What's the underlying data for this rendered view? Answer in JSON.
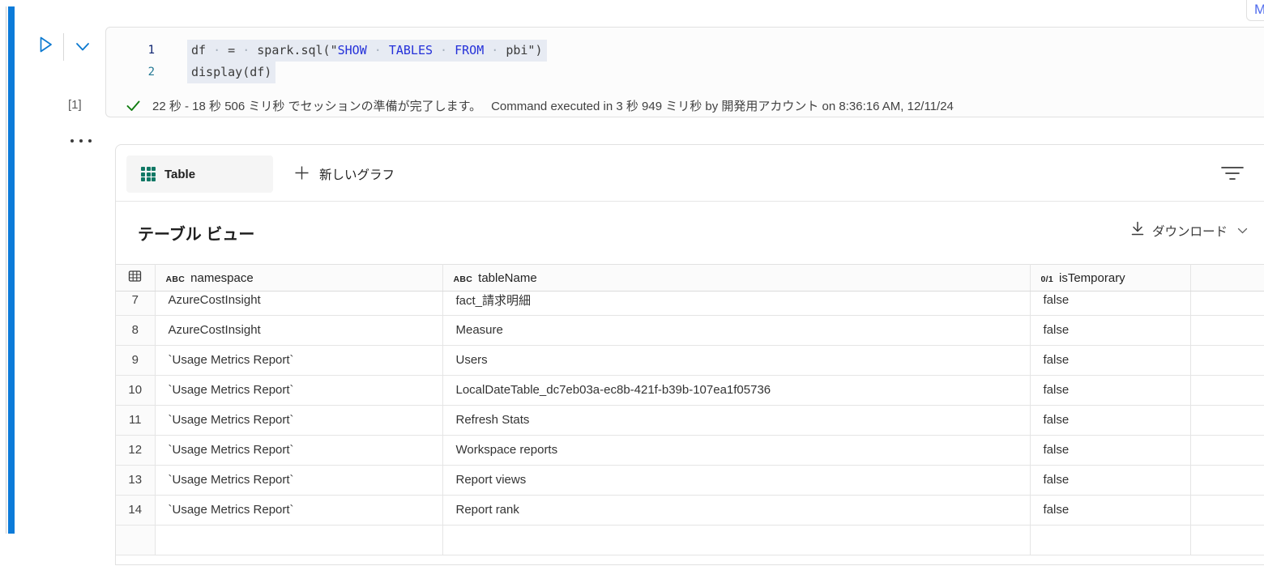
{
  "window": {
    "top_right_partial": "M"
  },
  "notebook_cell": {
    "execution_count": "[1]",
    "code_lines": [
      {
        "number": "1",
        "segments": [
          {
            "t": "df",
            "c": "d"
          },
          {
            "t": "·",
            "c": "w"
          },
          {
            "t": "=",
            "c": "d"
          },
          {
            "t": "·",
            "c": "w"
          },
          {
            "t": "spark.sql(\"",
            "c": "d"
          },
          {
            "t": "SHOW",
            "c": "k"
          },
          {
            "t": "·",
            "c": "w"
          },
          {
            "t": "TABLES",
            "c": "k"
          },
          {
            "t": "·",
            "c": "w"
          },
          {
            "t": "FROM",
            "c": "k"
          },
          {
            "t": "·",
            "c": "w"
          },
          {
            "t": "pbi\")",
            "c": "d"
          }
        ]
      },
      {
        "number": "2",
        "segments": [
          {
            "t": "display(df)",
            "c": "d"
          }
        ]
      }
    ],
    "status": {
      "session_message": "22 秒 - 18 秒 506 ミリ秒 でセッションの準備が完了します。",
      "execution_message": "Command executed in 3 秒 949 ミリ秒 by 開発用アカウント on 8:36:16 AM, 12/11/24"
    }
  },
  "output_panel": {
    "tabs": {
      "table": "Table",
      "new_chart": "新しいグラフ"
    },
    "view_title": "テーブル ビュー",
    "download_label": "ダウンロード",
    "table": {
      "columns": [
        {
          "badge": "ABC",
          "name": "namespace"
        },
        {
          "badge": "ABC",
          "name": "tableName"
        },
        {
          "badge": "0/1",
          "name": "isTemporary"
        }
      ],
      "rows": [
        {
          "num": "7",
          "namespace": "AzureCostInsight",
          "tableName": "fact_請求明細",
          "isTemporary": "false"
        },
        {
          "num": "8",
          "namespace": "AzureCostInsight",
          "tableName": "Measure",
          "isTemporary": "false"
        },
        {
          "num": "9",
          "namespace": "`Usage Metrics Report`",
          "tableName": "Users",
          "isTemporary": "false"
        },
        {
          "num": "10",
          "namespace": "`Usage Metrics Report`",
          "tableName": "LocalDateTable_dc7eb03a-ec8b-421f-b39b-107ea1f05736",
          "isTemporary": "false"
        },
        {
          "num": "11",
          "namespace": "`Usage Metrics Report`",
          "tableName": "Refresh Stats",
          "isTemporary": "false"
        },
        {
          "num": "12",
          "namespace": "`Usage Metrics Report`",
          "tableName": "Workspace reports",
          "isTemporary": "false"
        },
        {
          "num": "13",
          "namespace": "`Usage Metrics Report`",
          "tableName": "Report views",
          "isTemporary": "false"
        },
        {
          "num": "14",
          "namespace": "`Usage Metrics Report`",
          "tableName": "Report rank",
          "isTemporary": "false"
        }
      ]
    }
  },
  "colors": {
    "accent_blue": "#0C7BD9",
    "table_tab_green": "#117865",
    "check_green": "#107C10",
    "code_keyword_blue": "#2430D9",
    "line_number_active": "#0B216F",
    "line_number": "#237893"
  }
}
